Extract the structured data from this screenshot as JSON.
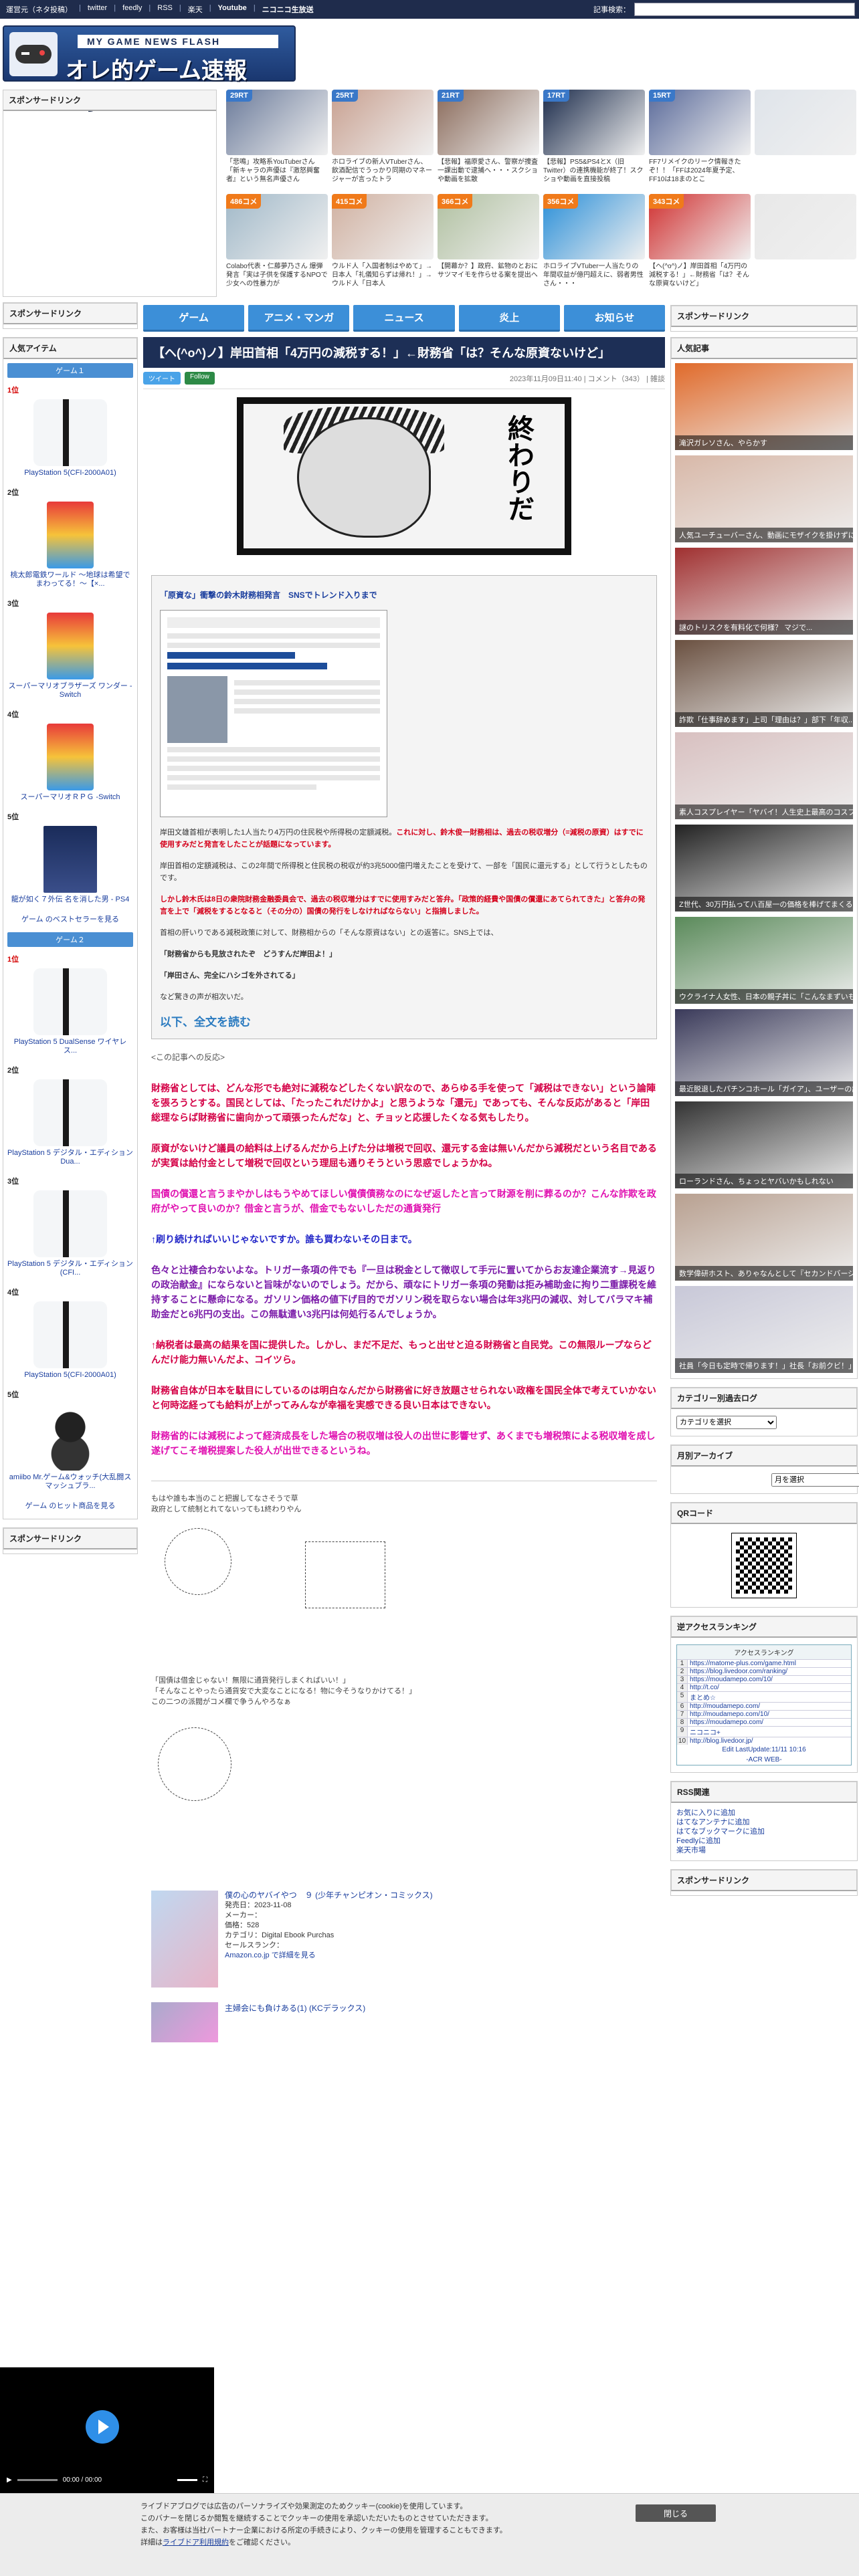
{
  "topbar": {
    "links": [
      "運営元（ネタ投稿）",
      "twitter",
      "feedly",
      "RSS",
      "楽天",
      "Youtube",
      "ニコニコ生放送"
    ],
    "search_label": "記事検索：",
    "search_value": ""
  },
  "logo": {
    "sub": "MY GAME NEWS FLASH",
    "main": "オレ的ゲーム速報@JIN"
  },
  "header_news": [],
  "left": {
    "sponsor_title": "スポンサードリンク",
    "sponsor_title2": "スポンサードリンク",
    "popular_title": "人気アイテム",
    "group1": "ゲーム１",
    "group2": "ゲーム２",
    "items1": [
      {
        "pos": "1位",
        "name": "PlayStation 5(CFI-2000A01)"
      },
      {
        "pos": "2位",
        "name": "桃太郎電鉄ワールド ～地球は希望でまわってる！～【×..."
      },
      {
        "pos": "3位",
        "name": "スーパーマリオブラザーズ ワンダー -Switch"
      },
      {
        "pos": "4位",
        "name": "スーパーマリオＲＰＧ -Switch"
      },
      {
        "pos": "5位",
        "name": "龍が如く７外伝 名を消した男 - PS4"
      }
    ],
    "more1": "ゲーム のベストセラーを見る",
    "items2": [
      {
        "pos": "1位",
        "name": "PlayStation 5 DualSense ワイヤレス..."
      },
      {
        "pos": "2位",
        "name": "PlayStation 5 デジタル・エディション Dua..."
      },
      {
        "pos": "3位",
        "name": "PlayStation 5 デジタル・エディション(CFI..."
      },
      {
        "pos": "4位",
        "name": "PlayStation 5(CFI-2000A01)"
      },
      {
        "pos": "5位",
        "name": "amiibo Mr.ゲーム&ウォッチ(大乱闘スマッシュブラ..."
      }
    ],
    "more2": "ゲーム のヒット商品を見る",
    "sponsor_title3": "スポンサードリンク"
  },
  "antenna": [
    {
      "badge": "29RT",
      "color": "blue",
      "caption": "「悲鳴」攻略系YouTuberさん「新キャラの声優は『激怒興奮者』という無名声優さん"
    },
    {
      "badge": "25RT",
      "color": "blue",
      "caption": "ホロライブの新人VTuberさん、飲酒配信でうっかり同期のマネージャーが言ったトラ"
    },
    {
      "badge": "21RT",
      "color": "blue",
      "caption": "【悲報】福原愛さん、警察が捜査一課出動で逮捕へ・・・スクショや動画を拡散"
    },
    {
      "badge": "17RT",
      "color": "blue",
      "caption": "【悲報】PS5&PS4とX（旧Twitter）の連携機能が終了！スクショや動画を直接投稿"
    },
    {
      "badge": "15RT",
      "color": "blue",
      "caption": "FF7リメイクのリーク情報きたぞ！！「FFは2024年夏予定、FF10は18まのとこ"
    },
    {
      "badge": "",
      "color": "blue",
      "caption": ""
    },
    {
      "badge": "486コメ",
      "color": "orange",
      "caption": "Colabo代表・仁藤夢乃さん 爆弾発言「実は子供を保護するNPOで少女への性暴力が"
    },
    {
      "badge": "415コメ",
      "color": "orange",
      "caption": "ウルド人「入国者制はやめて」→日本人「礼儀知らずは帰れ！」→ウルド人「日本人"
    },
    {
      "badge": "366コメ",
      "color": "orange",
      "caption": "【開幕か？】政府、鉱物のとおにサツマイモを作らせる案を提出へ"
    },
    {
      "badge": "356コメ",
      "color": "orange",
      "caption": "ホロライブVTuber一人当たりの年間収益が億円超えに、弱者男性さん・・・"
    },
    {
      "badge": "343コメ",
      "color": "orange",
      "caption": "【ヘ(^o^)ノ】岸田首相「4万円の減税する！」←財務省「は？そんな原資ないけど」"
    },
    {
      "badge": "",
      "color": "orange",
      "caption": ""
    }
  ],
  "tabs": [
    "ゲーム",
    "アニメ・マンガ",
    "ニュース",
    "炎上",
    "お知らせ"
  ],
  "article": {
    "title": "【ヘ(^o^)ノ】岸田首相「4万円の減税する！」←財務省「は？そんな原資ないけど」",
    "tweet_label": "ツイート",
    "follow_label": "Follow",
    "date": "2023年11月09日11:40",
    "comment": "コメント（343）",
    "tag": "雑談",
    "manga_text": "終わりだ",
    "quote_link": "「原資な」衝撃の鈴木財務相発言　SNSでトレンド入りまで",
    "q1": "岸田文雄首相が表明した1人当たり4万円の住民税や所得税の定額減税。",
    "q1red": "これに対し、鈴木俊一財務相は、過去の税収増分（=減税の原資）はすでに使用すみだと発言をしたことが話題になっています。",
    "q2": "岸田首相の定額減税は、この2年間で所得税と住民税の税収が約3兆5000億円増えたことを受けて、一部を「国民に還元する」として行うとしたものです。",
    "q3": "しかし鈴木氏は8日の衆院財務金融委員会で、過去の税収増分はすでに使用すみだと答弁。「政策的経費や国債の償還にあてられてきた」と答弁の発言を上で「減税をするとなると（その分の）国債の発行をしなければならない」と指摘しました。",
    "q4": "首相の肝いりである減税政策に対して、財務相からの「そんな原資はない」との返答に。SNS上では、",
    "q5": "「財務省からも見放されたぞ　どうすんだ岸田よ！」",
    "q6": "「岸田さん、完全にハシゴを外されてる」",
    "q7": "など驚きの声が相次いだ。",
    "readmore": "以下、全文を読む",
    "comment_label": "<この記事への反応>",
    "comments": [
      {
        "cls": "c-red",
        "text": "財務省としては、どんな形でも絶対に減税などしたくない訳なので、あらゆる手を使って「減税はできない」という論陣を張ろうとする。国民としては、「たったこれだけかよ」と思うような「還元」であっても、そんな反応があると「岸田総理ならば財務省に歯向かって頑張ったんだな」と、チョッと応援したくなる気もしたり。"
      },
      {
        "cls": "c-red",
        "text": "原資がないけど議員の給料は上げるんだから上げた分は増税で回収、還元する金は無いんだから減税だという名目であるが実質は給付金として増税で回収という理屈も通りそうという思惑でしょうかね。"
      },
      {
        "cls": "c-mag",
        "text": "国債の償還と言うまやかしはもうやめてほしい償債債務なのになぜ返したと言って財源を削に葬るのか？こんな詐欺を政府がやって良いのか？借金と言うが、借金でもないしただの通貨発行"
      },
      {
        "cls": "c-blue",
        "text": "↑刷り続ければいいじゃないですか。誰も買わないその日まで。"
      },
      {
        "cls": "c-purp",
        "text": "色々と辻褄合わないよな。トリガー条項の件でも『一旦は税金として徴収して手元に置いてからお友達企業流す→見返りの政治献金』にならないと旨味がないのでしょう。だから、頑なにトリガー条項の発動は拒み補助金に拘り二重課税を維持することに懸命になる。ガソリン価格の値下げ目的でガソリン税を取らない場合は年3兆円の減収、対してバラマキ補助金だと6兆円の支出。この無駄遣い3兆円は何処行るんでしょうか。"
      },
      {
        "cls": "c-red",
        "text": "↑納税者は最高の結果を国に提供した。しかし、まだ不足だ、もっと出せと迫る財務省と自民党。この無限ループならどんだけ能力無いんだよ、コイツら。"
      },
      {
        "cls": "c-red",
        "text": "財務省自体が日本を駄目にしているのは明白なんだから財務省に好き放題させられない政権を国民全体で考えていかないと何時迄経っても給料が上がってみんなが幸福を実感できる良い日本はできない。"
      },
      {
        "cls": "c-mag",
        "text": "財務省的には減税によって経済成長をした場合の税収増は役人の出世に影響せず、あくまでも増税策による税収増を成し遂げてこそ増税提案した役人が出世できるというね。"
      }
    ],
    "aa1_line1": "もはや誰も本当のこと把握してなさそうで草",
    "aa1_line2": "政府として統制とれてないっても1終わりやん",
    "aa2_line1": "「国債は借金じゃない！無限に通貨発行しまくればいい！」",
    "aa2_line2": "「そんなことやったら通貨安で大変なことになる！物に今そうなりかけてる！」",
    "aa2_line3": "この二つの派閥がコメ欄で争うんやろなぁ",
    "product": {
      "title": "僕の心のヤバイやつ　９ (少年チャンピオン・コミックス)",
      "release": "発売日：2023-11-08",
      "maker": "メーカー：",
      "price": "価格：528",
      "category": "カテゴリ：Digital Ebook Purchas",
      "rank": "セールスランク：",
      "amazon": "Amazon.co.jp で詳細を見る"
    },
    "product2_title": "主婦会にも負けある(1) (KCデラックス)"
  },
  "right": {
    "sponsor_title": "スポンサードリンク",
    "popular_title": "人気記事",
    "popular": [
      "滝沢ガレソさん、やらかす",
      "人気ユーチューバーさん、動画にモザイクを掛けずにうっかり...",
      "謎のトリスクを有料化で何様？ マジで...",
      "詐欺「仕事辞めます」上司「理由は？」部下「年収..."
    ],
    "popular_more": [
      "素人コスプレイヤー「ヤバイ！人生史上最高のコスプレ写真撮れた！」",
      "Z世代、30万円払って八百屋一の価格を棒げてまくる",
      "ウクライナ人女性、日本の親子丼に「こんなまずいもの無理！行き止まり...",
      "最近脱退したパチンコホール「ガイア」、ユーザーの評判最悪でも業績...",
      "ローランドさん、ちょっとヤバいかもしれない",
      "数学偉研ホスト、ありゃなんとして『セカンドバージン』化をご...",
      "社員「今日も定時で帰ります！」社長「お前クビ！」→..."
    ],
    "cat_title": "カテゴリー別過去ログ",
    "cat_select": "カテゴリを選択",
    "month_title": "月別アーカイブ",
    "month_select": "月を選択",
    "qr_title": "QRコード",
    "access_title": "逆アクセスランキング",
    "access_head": "アクセスランキング",
    "access_rows": [
      "https://matome-plus.com/game.html",
      "https://blog.livedoor.com/ranking/",
      "https://moudamepo.com/10/",
      "http://t.co/",
      "まとめ☆",
      "http://moudamepo.com/",
      "http://moudamepo.com/10/",
      "https://moudamepo.com/",
      "ニコニコ+",
      "http://blog.livedoor.jp/"
    ],
    "access_foot": "Edit LastUpdate:11/11 10:16",
    "access_foot2": "-ACR WEB-",
    "rss_title": "RSS関連",
    "rss_links": [
      "お気に入りに追加",
      "はてなアンテナに追加",
      "はてなブックマークに追加",
      "Feedlyに追加",
      "楽天市場"
    ],
    "sponsor_title2": "スポンサードリンク"
  },
  "video": {
    "time": "00:00 / 00:00"
  },
  "cookie": {
    "line1": "ライブドアブログでは広告のパーソナライズや効果測定のためクッキー(cookie)を使用しています。",
    "line2": "このバナーを閉じるか閲覧を継続することでクッキーの使用を承認いただいたものとさせていただきます。",
    "line3": "また、お客様は当社パートナー企業における所定の手続きにより、クッキーの使用を管理することもできます。",
    "line4a": "詳細は",
    "line4link": "ライブドア利用規約",
    "line4b": "をご確認ください。",
    "close": "閉じる"
  }
}
